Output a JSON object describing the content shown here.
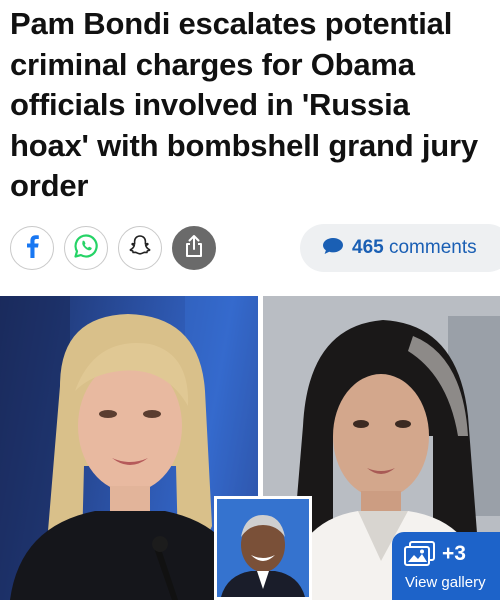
{
  "article": {
    "headline": "Pam Bondi escalates potential criminal charges for Obama officials involved in 'Russia hoax' with bombshell grand jury order"
  },
  "share_bar": {
    "buttons": [
      {
        "name": "facebook",
        "icon": "facebook-icon"
      },
      {
        "name": "whatsapp",
        "icon": "whatsapp-icon"
      },
      {
        "name": "snapchat",
        "icon": "snapchat-icon"
      },
      {
        "name": "share",
        "icon": "share-icon"
      }
    ],
    "comments": {
      "count": "465",
      "label": "comments",
      "icon": "speech-bubble-icon"
    }
  },
  "gallery": {
    "count": "+3",
    "label": "View gallery",
    "icon": "gallery-icon"
  },
  "colors": {
    "headline": "#111111",
    "facebook": "#1877f2",
    "whatsapp": "#25d366",
    "accent_blue": "#1a5fb4",
    "gallery_bg": "#1d63c9",
    "share_dark": "#6a6a6a"
  }
}
